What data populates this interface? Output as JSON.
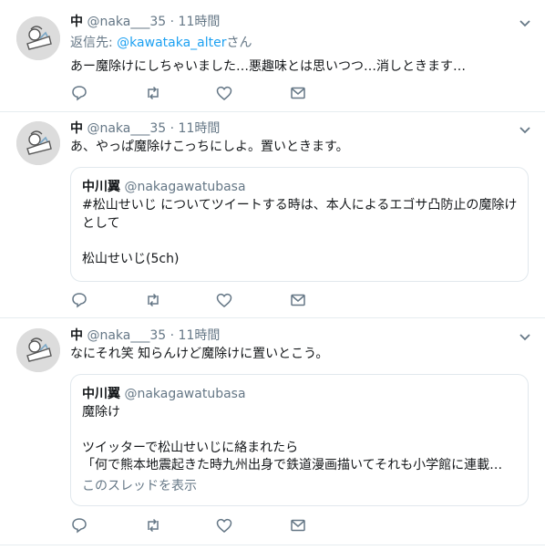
{
  "colors": {
    "text": "#14171a",
    "muted": "#657786",
    "link": "#1da1f2",
    "border": "#e6ecf0"
  },
  "icons": [
    "avatar-illustration",
    "chevron-down-icon",
    "reply-icon",
    "retweet-icon",
    "like-icon",
    "message-icon"
  ],
  "tweets": [
    {
      "name": "中",
      "handle": "@naka___35",
      "sep": "·",
      "time": "11時間",
      "reply_prefix": "返信先: ",
      "reply_mention": "@kawataka_alter",
      "reply_suffix": "さん",
      "text": "あー魔除けにしちゃいました…悪趣味とは思いつつ…消しときます…"
    },
    {
      "name": "中",
      "handle": "@naka___35",
      "sep": "·",
      "time": "11時間",
      "text": "あ、やっぱ魔除けこっちにしよ。置いときます。",
      "quote": {
        "name": "中川翼",
        "handle": "@nakagawatubasa",
        "line1": "#松山せいじ についてツイートする時は、本人によるエゴサ凸防止の魔除け",
        "line2": "として",
        "line3": "松山せいじ(5ch)"
      }
    },
    {
      "name": "中",
      "handle": "@naka___35",
      "sep": "·",
      "time": "11時間",
      "text": "なにそれ笑 知らんけど魔除けに置いとこう。",
      "quote": {
        "name": "中川翼",
        "handle": "@nakagawatubasa",
        "line1": "魔除け",
        "line2": "ツイッターで松山せいじに絡まれたら",
        "line3": "「何で熊本地震起きた時九州出身で鉄道漫画描いてそれも小学館に連載…",
        "more": "このスレッドを表示"
      }
    }
  ]
}
